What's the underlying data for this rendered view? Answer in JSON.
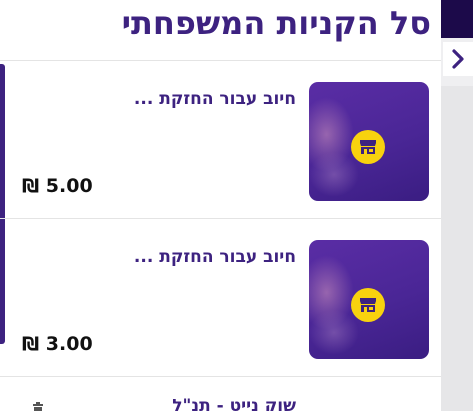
{
  "header": {
    "title": "סל הקניות המשפחתי"
  },
  "items": [
    {
      "title": "חיוב עבור החזקת ...",
      "price": "5.00 ₪",
      "icon": "store-icon"
    },
    {
      "title": "חיוב עבור החזקת ...",
      "price": "3.00 ₪",
      "icon": "store-icon"
    }
  ],
  "partial_item": {
    "title": "שוק נייט - תנ\"ל"
  },
  "side": {
    "back_icon": "chevron-right-icon"
  },
  "colors": {
    "accent": "#3d2280",
    "badge": "#f8d20e",
    "dark": "#1c0a4a"
  }
}
